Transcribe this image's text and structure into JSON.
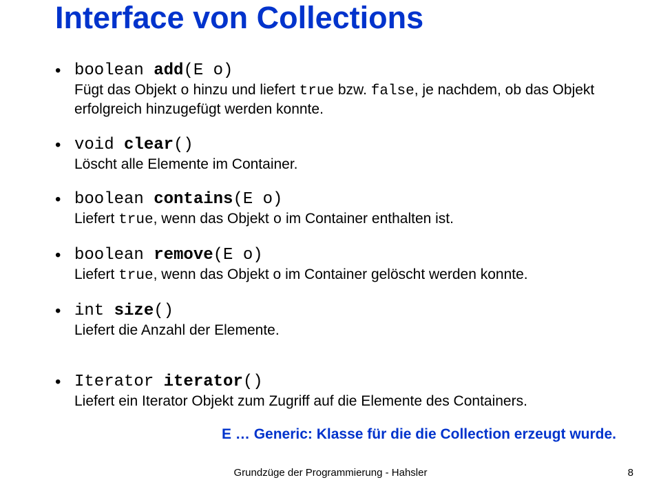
{
  "title": "Interface von Collections",
  "bullets": [
    {
      "sig_pre": "boolean ",
      "sig_bold": "add",
      "sig_post": "(E o)",
      "desc_parts": [
        "Fügt das Objekt ",
        "o",
        " hinzu und liefert ",
        "true",
        " bzw. ",
        "false",
        ", je nachdem, ob das Objekt erfolgreich hinzugefügt werden konnte."
      ]
    },
    {
      "sig_pre": "void ",
      "sig_bold": "clear",
      "sig_post": "()",
      "desc_parts": [
        "Löscht alle Elemente im Container."
      ]
    },
    {
      "sig_pre": "boolean ",
      "sig_bold": "contains",
      "sig_post": "(E o)",
      "desc_parts": [
        "Liefert ",
        "true",
        ", wenn das Objekt ",
        "o",
        " im Container enthalten ist."
      ]
    },
    {
      "sig_pre": "boolean ",
      "sig_bold": "remove",
      "sig_post": "(E o)",
      "desc_parts": [
        "Liefert ",
        "true",
        ", wenn das Objekt o im Container gelöscht werden konnte."
      ]
    },
    {
      "sig_pre": "int ",
      "sig_bold": "size",
      "sig_post": "()",
      "desc_parts": [
        "Liefert die Anzahl der Elemente."
      ]
    },
    {
      "sig_pre": "Iterator ",
      "sig_bold": "iterator",
      "sig_post": "()",
      "desc_parts": [
        "Liefert ein Iterator Objekt zum Zugriff auf die Elemente des Containers."
      ]
    }
  ],
  "generic_note": "E … Generic: Klasse für die die Collection erzeugt wurde.",
  "footer": "Grundzüge der Programmierung  - Hahsler",
  "page_num": "8"
}
